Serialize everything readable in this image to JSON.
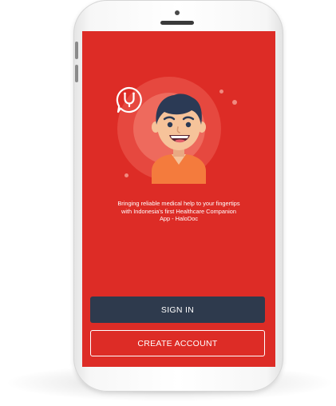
{
  "app": {
    "tagline": "Bringing reliable medical help to your fingertips\nwith Indonesia's first Healthcare Companion\nApp - HaloDoc"
  },
  "actions": {
    "sign_in_label": "SIGN IN",
    "create_account_label": "CREATE ACCOUNT"
  },
  "icons": {
    "logo": "stethoscope-chat-bubble-icon",
    "illustration": "smiling-boy-avatar"
  },
  "colors": {
    "screen_background": "#dd2c26",
    "sign_in_button": "#2e3a4d",
    "button_text": "#ffffff",
    "avatar_shirt": "#f47b3d",
    "avatar_hair": "#2b3a55",
    "avatar_skin": "#f6c39a"
  }
}
